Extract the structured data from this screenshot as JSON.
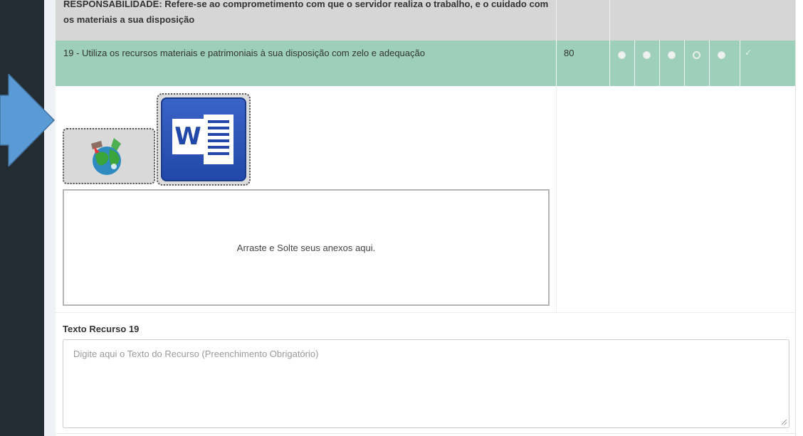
{
  "section": {
    "title": "RESPONSABILIDADE: Refere-se ao comprometimento com que o servidor realiza o trabalho, e o cuidado com os materiais a sua disposição"
  },
  "question": {
    "text": "19 - Utiliza os recursos materiais e patrimoniais à sua disposição com zelo e adequação",
    "score": "80",
    "options": [
      {
        "selected": false
      },
      {
        "selected": false
      },
      {
        "selected": false
      },
      {
        "selected": true
      },
      {
        "selected": false
      }
    ],
    "check_icon": "check-icon",
    "row_color": "#9dcfbb"
  },
  "attachments": {
    "items": [
      {
        "icon": "globe-map-icon"
      },
      {
        "icon": "microsoft-word-icon",
        "letter": "W"
      }
    ],
    "dropzone_text": "Arraste e Solte seus anexos aqui."
  },
  "resource": {
    "label": "Texto Recurso 19",
    "value": "",
    "placeholder": "Digite aqui o Texto do Recurso (Preenchimento Obrigatório)"
  },
  "pointer": {
    "icon": "arrow-right-icon",
    "color": "#5b9bd5"
  }
}
